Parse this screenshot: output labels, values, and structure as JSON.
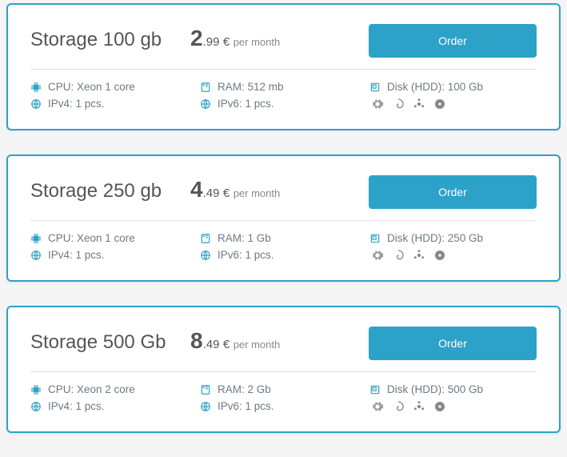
{
  "common": {
    "order_label": "Order",
    "period_label": "per month",
    "currency": "€"
  },
  "plans": [
    {
      "title": "Storage 100 gb",
      "price_whole": "2",
      "price_decimal": ".99",
      "cpu": "CPU: Xeon 1 core",
      "ram": "RAM: 512 mb",
      "disk": "Disk (HDD): 100 Gb",
      "ipv4": "IPv4: 1 pcs.",
      "ipv6": "IPv6: 1 pcs."
    },
    {
      "title": "Storage 250 gb",
      "price_whole": "4",
      "price_decimal": ".49",
      "cpu": "CPU: Xeon 1 core",
      "ram": "RAM: 1 Gb",
      "disk": "Disk (HDD): 250 Gb",
      "ipv4": "IPv4: 1 pcs.",
      "ipv6": "IPv6: 1 pcs."
    },
    {
      "title": "Storage 500 Gb",
      "price_whole": "8",
      "price_decimal": ".49",
      "cpu": "CPU: Xeon 2 core",
      "ram": "RAM: 2 Gb",
      "disk": "Disk (HDD): 500 Gb",
      "ipv4": "IPv4: 1 pcs.",
      "ipv6": "IPv6: 1 pcs."
    }
  ]
}
